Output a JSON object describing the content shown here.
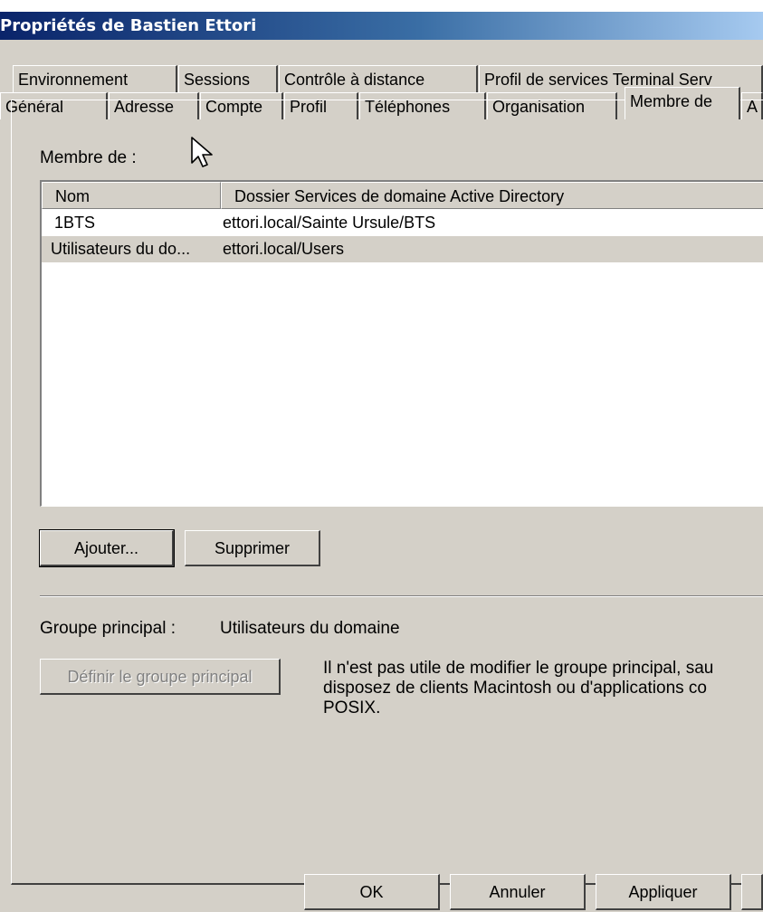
{
  "window": {
    "title": "Propriétés de Bastien Ettori"
  },
  "tabs_row1": [
    "Environnement",
    "Sessions",
    "Contrôle à distance",
    "Profil de services Terminal Serv"
  ],
  "tabs_row2": [
    "Général",
    "Adresse",
    "Compte",
    "Profil",
    "Téléphones",
    "Organisation",
    "Membre de",
    "A"
  ],
  "active_tab": "Membre de",
  "member_of": {
    "label": "Membre de :",
    "columns": [
      "Nom",
      "Dossier Services de domaine Active Directory"
    ],
    "rows": [
      {
        "name": "1BTS",
        "folder": "ettori.local/Sainte Ursule/BTS",
        "selected": false
      },
      {
        "name": "Utilisateurs du do...",
        "folder": "ettori.local/Users",
        "selected": true
      }
    ]
  },
  "buttons": {
    "add": "Ajouter...",
    "remove": "Supprimer"
  },
  "primary_group": {
    "label": "Groupe principal :",
    "value": "Utilisateurs du domaine",
    "set_button": "Définir le groupe principal",
    "info_line1": "Il n'est pas utile de modifier le groupe principal, sau",
    "info_line2": "disposez de clients Macintosh ou d'applications co",
    "info_line3": "POSIX."
  },
  "footer": {
    "ok": "OK",
    "cancel": "Annuler",
    "apply": "Appliquer"
  },
  "colors": {
    "dialog_bg": "#d4d0c8",
    "titlebar_start": "#0a246a",
    "titlebar_end": "#a6caf0"
  },
  "icons": {
    "cursor": "arrow-cursor-icon"
  }
}
